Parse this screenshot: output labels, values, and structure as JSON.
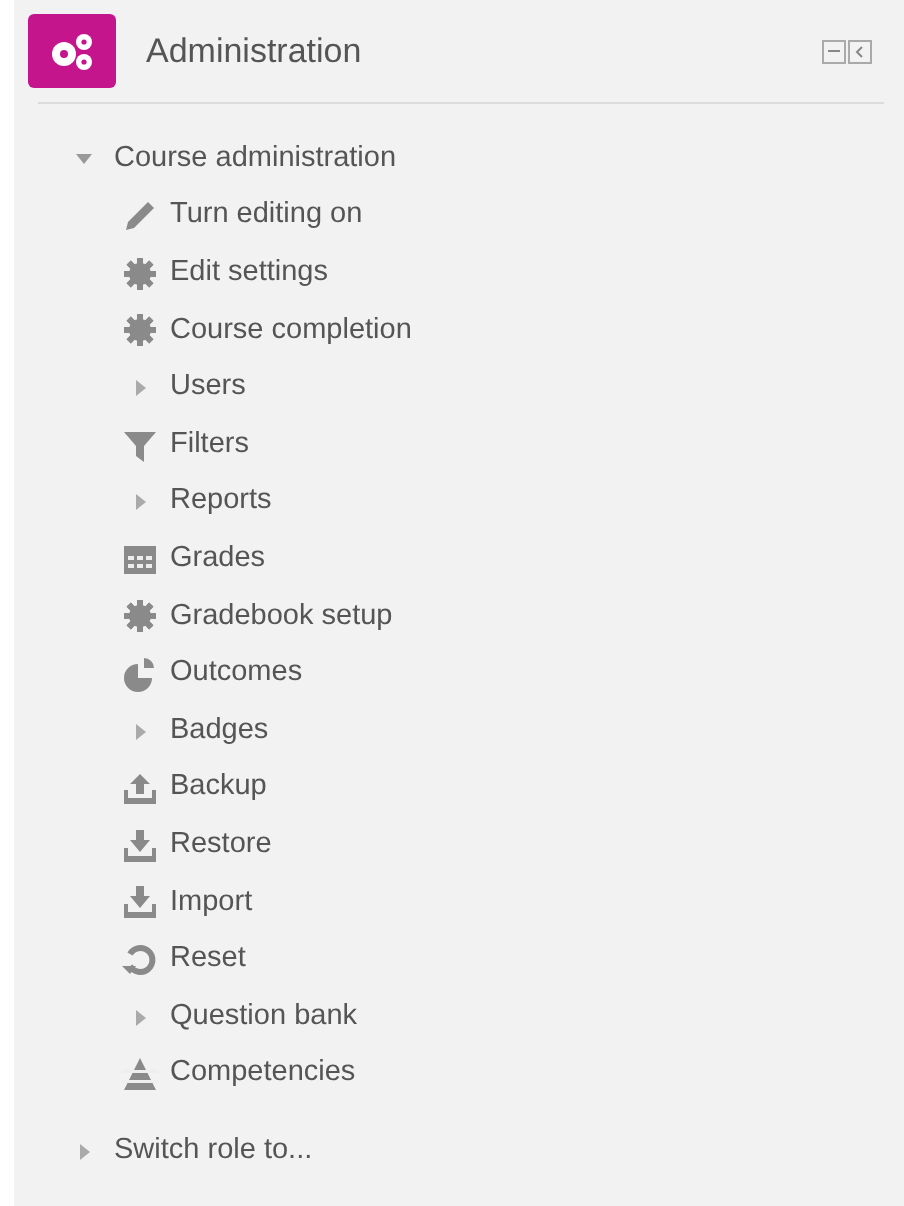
{
  "block": {
    "title": "Administration"
  },
  "tree": [
    {
      "label": "Course administration",
      "expanded": true,
      "children": [
        {
          "label": "Turn editing on",
          "kind": "pencil"
        },
        {
          "label": "Edit settings",
          "kind": "gear"
        },
        {
          "label": "Course completion",
          "kind": "gear"
        },
        {
          "label": "Users",
          "kind": "branch",
          "expanded": false
        },
        {
          "label": "Filters",
          "kind": "filter"
        },
        {
          "label": "Reports",
          "kind": "branch",
          "expanded": false
        },
        {
          "label": "Grades",
          "kind": "table"
        },
        {
          "label": "Gradebook setup",
          "kind": "gear"
        },
        {
          "label": "Outcomes",
          "kind": "pie"
        },
        {
          "label": "Badges",
          "kind": "branch",
          "expanded": false
        },
        {
          "label": "Backup",
          "kind": "upload"
        },
        {
          "label": "Restore",
          "kind": "download"
        },
        {
          "label": "Import",
          "kind": "download"
        },
        {
          "label": "Reset",
          "kind": "reset"
        },
        {
          "label": "Question bank",
          "kind": "branch",
          "expanded": false
        },
        {
          "label": "Competencies",
          "kind": "pyramid"
        }
      ]
    },
    {
      "label": "Switch role to...",
      "expanded": false
    }
  ]
}
